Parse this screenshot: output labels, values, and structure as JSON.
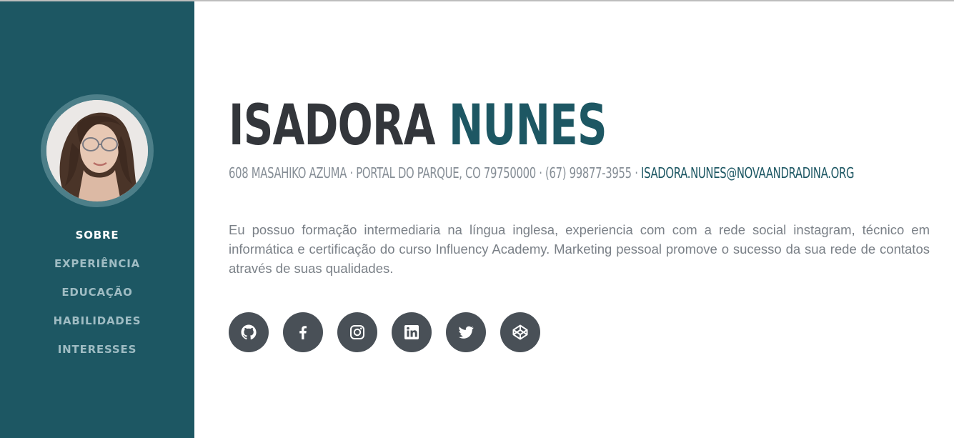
{
  "profile": {
    "first_name": "ISADORA",
    "last_name": "NUNES",
    "address": "608 MASAHIKO AZUMA · PORTAL DO PARQUE, CO 79750000 · (67) 99877-3955 · ",
    "email": "ISADORA.NUNES@NOVAANDRADINA.ORG",
    "about": "Eu possuo formação intermediaria na língua inglesa, experiencia com com a rede social instagram, técnico em informática e certificação do curso Influency Academy. Marketing pessoal promove o sucesso da sua rede de contatos através de suas qualidades."
  },
  "nav": {
    "items": [
      {
        "label": "SOBRE",
        "active": true
      },
      {
        "label": "EXPERIÊNCIA",
        "active": false
      },
      {
        "label": "EDUCAÇÃO",
        "active": false
      },
      {
        "label": "HABILIDADES",
        "active": false
      },
      {
        "label": "INTERESSES",
        "active": false
      }
    ]
  },
  "social": {
    "icons": [
      "github-icon",
      "facebook-icon",
      "instagram-icon",
      "linkedin-icon",
      "twitter-icon",
      "codepen-icon"
    ]
  },
  "colors": {
    "sidebar": "#1d5763",
    "accent": "#1d5763",
    "heading": "#33363b",
    "social_bg": "#495057",
    "nav_inactive": "#9fbcc3"
  }
}
